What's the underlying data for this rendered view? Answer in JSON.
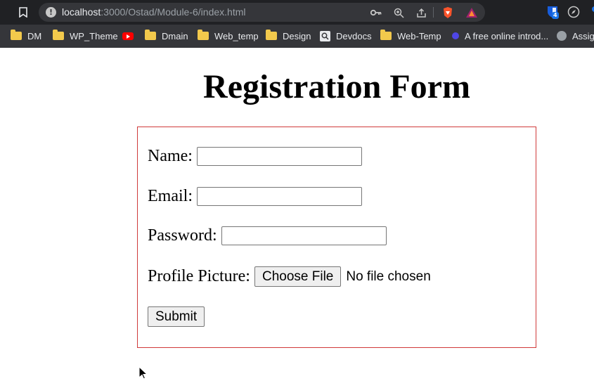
{
  "browser": {
    "url_host": "localhost",
    "url_path": ":3000/Ostad/Module-6/index.html",
    "extension_badge": "4"
  },
  "bookmarks": [
    {
      "label": "DM",
      "icon": "folder-icon"
    },
    {
      "label": "WP_Theme",
      "icon": "folder-icon"
    },
    {
      "label": "",
      "icon": "youtube-icon"
    },
    {
      "label": "Dmain",
      "icon": "folder-icon"
    },
    {
      "label": "Web_temp",
      "icon": "folder-icon"
    },
    {
      "label": "Design",
      "icon": "folder-icon"
    },
    {
      "label": "Devdocs",
      "icon": "devdocs-icon"
    },
    {
      "label": "Web-Temp",
      "icon": "folder-icon"
    },
    {
      "label": "A free online introd...",
      "icon": "dot-icon"
    },
    {
      "label": "Assign",
      "icon": "globe-icon"
    }
  ],
  "page": {
    "title": "Registration Form"
  },
  "form": {
    "name_label": "Name:",
    "name_value": "",
    "email_label": "Email:",
    "email_value": "",
    "password_label": "Password:",
    "password_value": "",
    "picture_label": "Profile Picture:",
    "choose_file_label": "Choose File",
    "file_status": "No file chosen",
    "submit_label": "Submit"
  },
  "colors": {
    "form_border": "#d03a3a",
    "chrome_dark": "#202124"
  }
}
